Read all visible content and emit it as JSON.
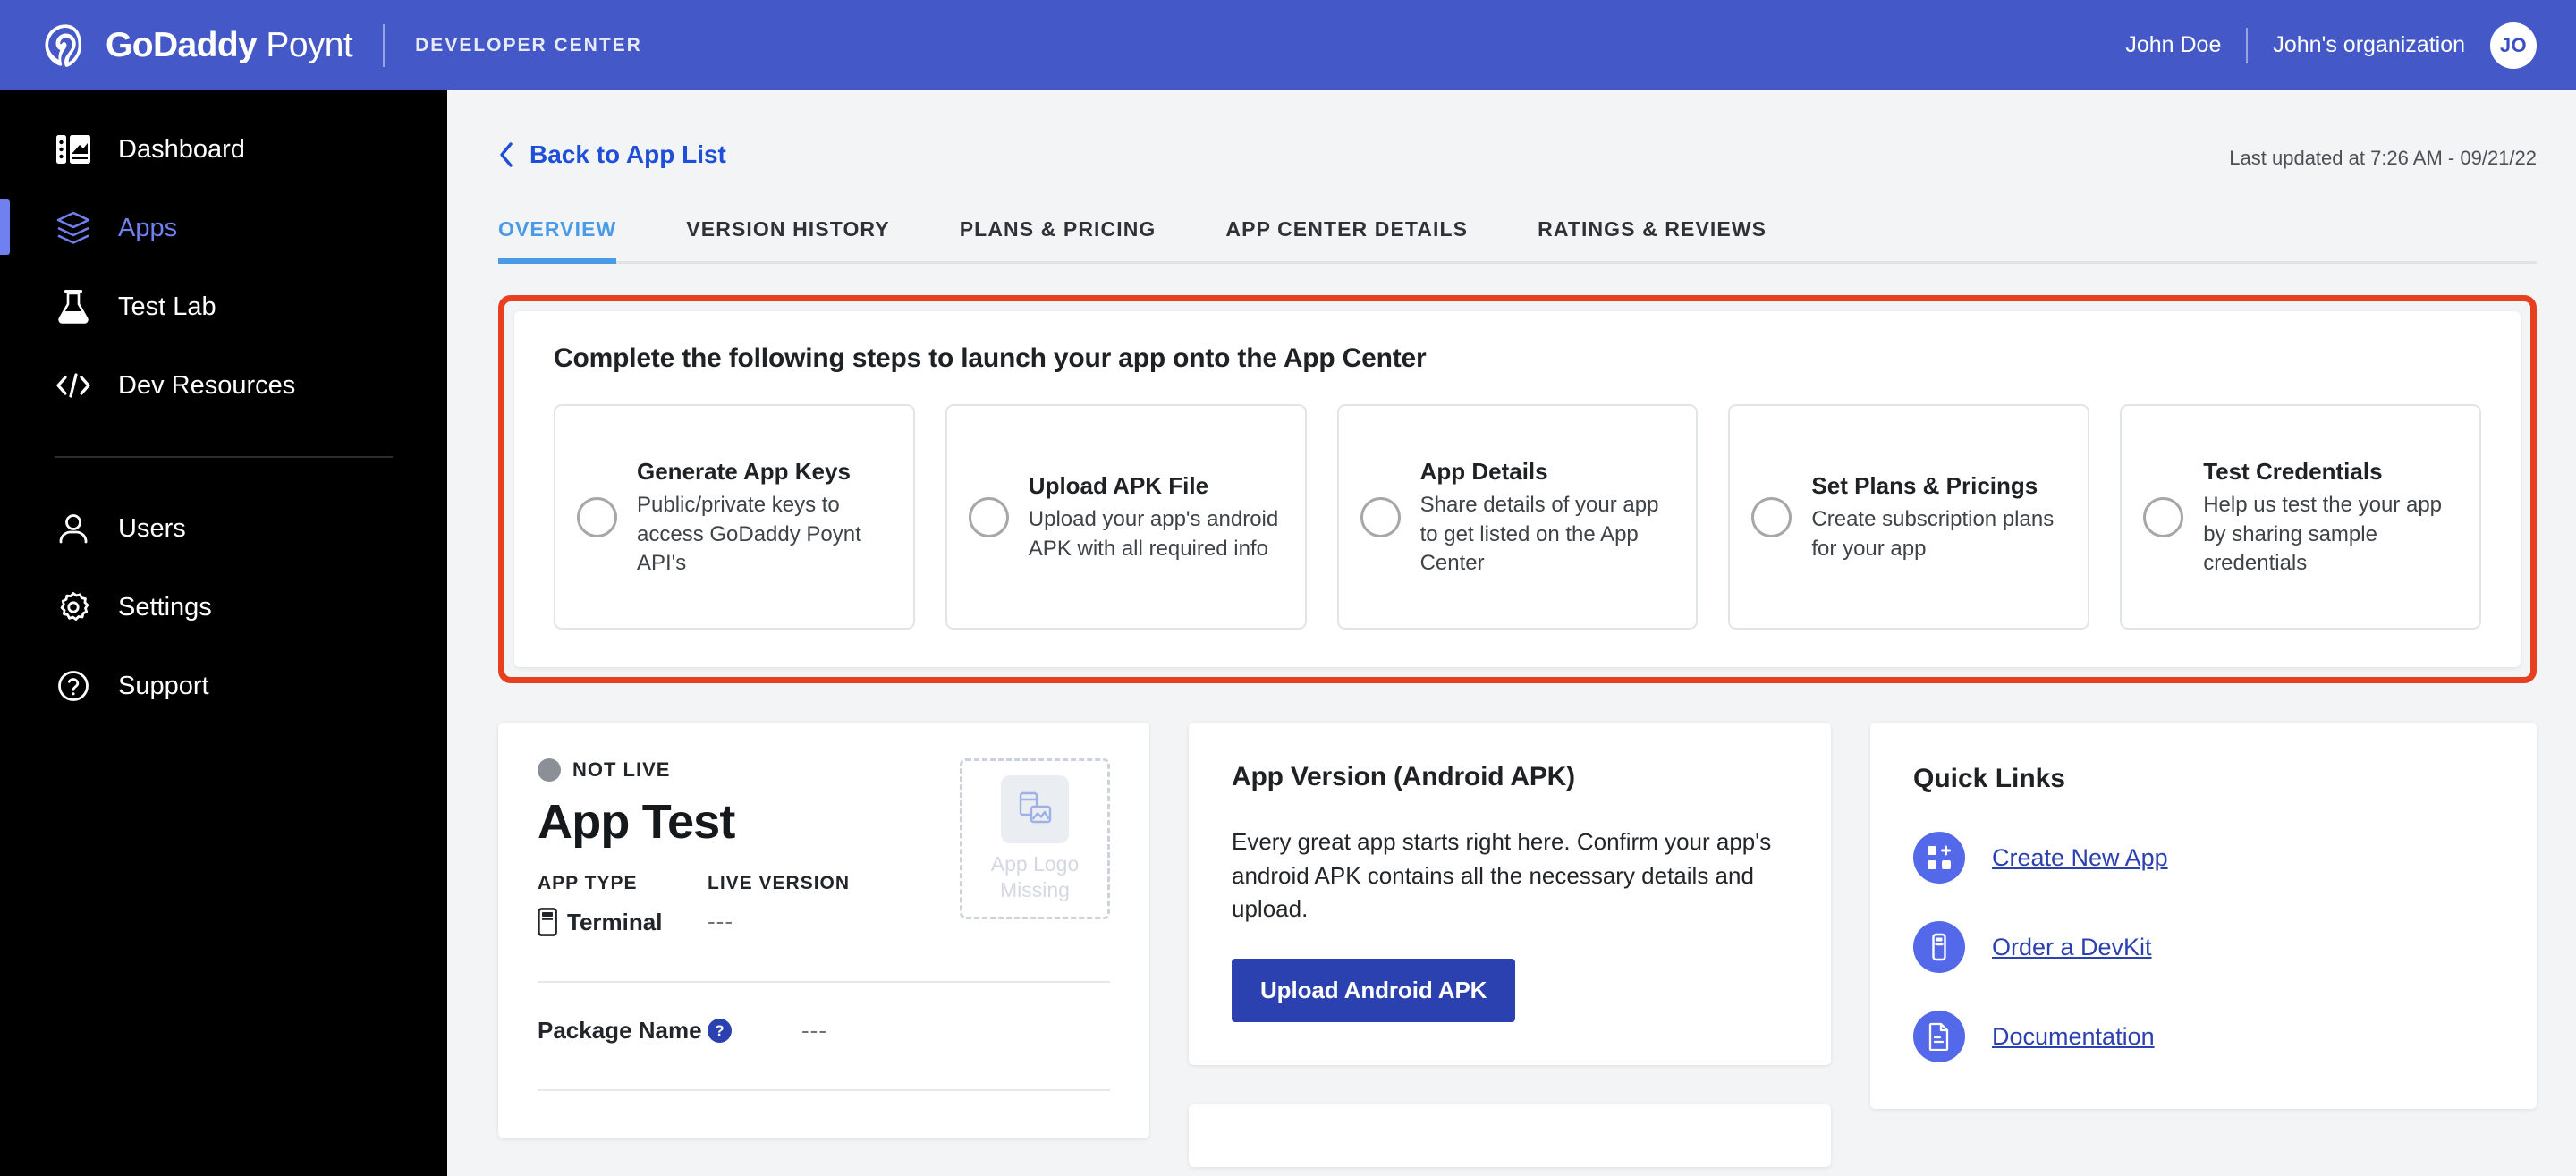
{
  "topbar": {
    "brand_bold": "GoDaddy",
    "brand_light": "Poynt",
    "section": "DEVELOPER CENTER",
    "user_name": "John Doe",
    "org_name": "John's organization",
    "avatar_initials": "JO",
    "brand_color": "#4458c8"
  },
  "sidebar": {
    "items": [
      {
        "label": "Dashboard",
        "icon": "dashboard-icon",
        "active": false
      },
      {
        "label": "Apps",
        "icon": "layers-icon",
        "active": true
      },
      {
        "label": "Test Lab",
        "icon": "flask-icon",
        "active": false
      },
      {
        "label": "Dev Resources",
        "icon": "code-icon",
        "active": false
      }
    ],
    "items_secondary": [
      {
        "label": "Users",
        "icon": "user-icon"
      },
      {
        "label": "Settings",
        "icon": "gear-icon"
      },
      {
        "label": "Support",
        "icon": "question-circle-icon"
      }
    ],
    "active_color": "#7080ee"
  },
  "page": {
    "back_label": "Back to App List",
    "last_updated": "Last updated at 7:26 AM - 09/21/22"
  },
  "tabs": [
    {
      "label": "OVERVIEW",
      "active": true
    },
    {
      "label": "VERSION HISTORY",
      "active": false
    },
    {
      "label": "PLANS & PRICING",
      "active": false
    },
    {
      "label": "APP CENTER DETAILS",
      "active": false
    },
    {
      "label": "RATINGS & REVIEWS",
      "active": false
    }
  ],
  "steps_panel": {
    "highlight_color": "#e8401f",
    "title": "Complete the following steps to launch your app onto the App Center",
    "steps": [
      {
        "title": "Generate App Keys",
        "desc": "Public/private keys to access GoDaddy Poynt API's",
        "checked": false
      },
      {
        "title": "Upload APK File",
        "desc": "Upload your app's android APK with all required info",
        "checked": false
      },
      {
        "title": "App Details",
        "desc": "Share details of your app to get listed on the App Center",
        "checked": false
      },
      {
        "title": "Set Plans & Pricings",
        "desc": "Create subscription plans for your app",
        "checked": false
      },
      {
        "title": "Test Credentials",
        "desc": "Help us test the your app by sharing sample credentials",
        "checked": false
      }
    ]
  },
  "app_info": {
    "status": "NOT LIVE",
    "name": "App Test",
    "app_type_label": "APP TYPE",
    "app_type_value": "Terminal",
    "live_version_label": "LIVE VERSION",
    "live_version_value": "---",
    "logo_missing_line1": "App Logo",
    "logo_missing_line2": "Missing",
    "package_name_label": "Package Name",
    "package_name_help": "?",
    "package_name_value": "---"
  },
  "apk_card": {
    "title": "App Version (Android APK)",
    "desc": "Every great app starts right here. Confirm your app's android APK contains all the necessary details and upload.",
    "button": "Upload Android APK"
  },
  "quick_links": {
    "title": "Quick Links",
    "links": [
      {
        "label": "Create New App",
        "icon": "grid-plus-icon"
      },
      {
        "label": "Order a DevKit",
        "icon": "terminal-device-icon"
      },
      {
        "label": "Documentation",
        "icon": "document-icon"
      }
    ]
  }
}
